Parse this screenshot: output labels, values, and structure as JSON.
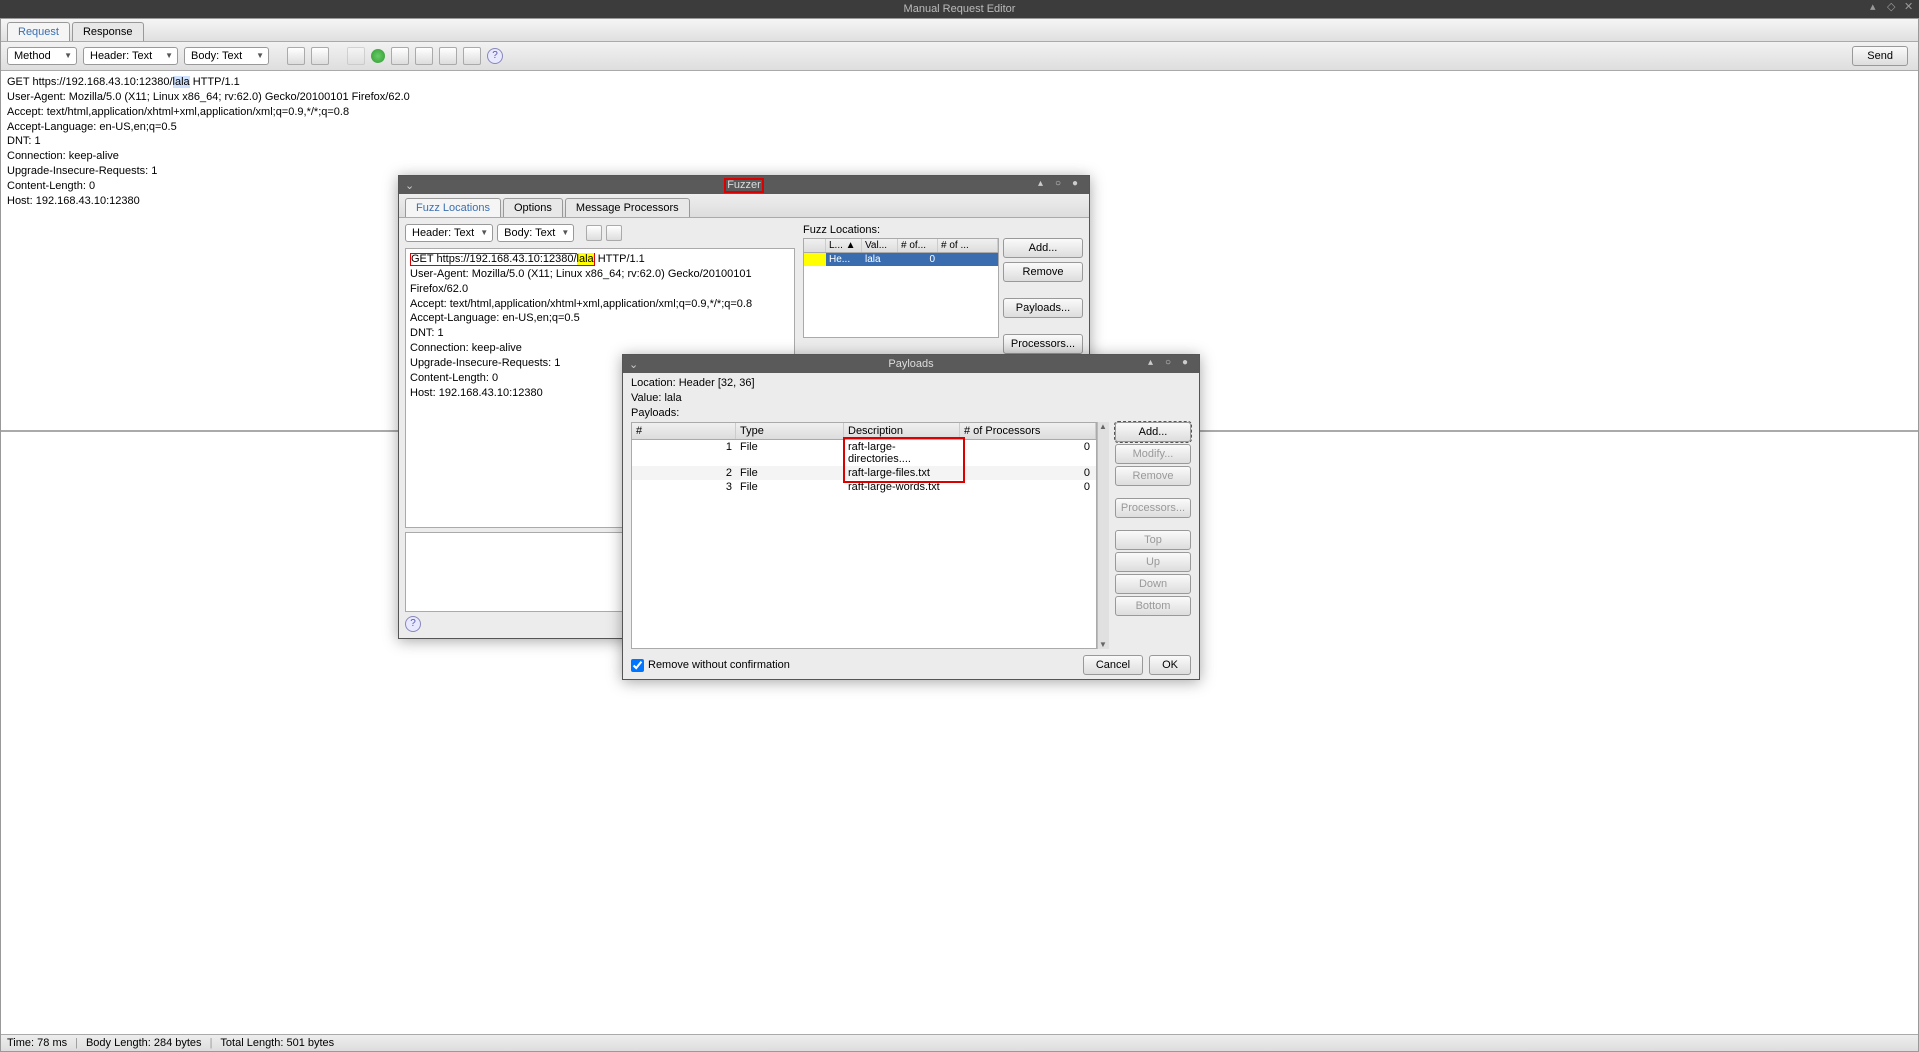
{
  "window": {
    "title": "Manual Request Editor"
  },
  "tabs": {
    "request": "Request",
    "response": "Response"
  },
  "toolbar": {
    "method": "Method",
    "header_text": "Header: Text",
    "body_text": "Body: Text",
    "send": "Send"
  },
  "request_pre": "GET https://192.168.43.10:12380/",
  "request_highlight": "lala",
  "request_post": " HTTP/1.1\nUser-Agent: Mozilla/5.0 (X11; Linux x86_64; rv:62.0) Gecko/20100101 Firefox/62.0\nAccept: text/html,application/xhtml+xml,application/xml;q=0.9,*/*;q=0.8\nAccept-Language: en-US,en;q=0.5\nDNT: 1\nConnection: keep-alive\nUpgrade-Insecure-Requests: 1\nContent-Length: 0\nHost: 192.168.43.10:12380",
  "status": {
    "time": "Time: 78 ms",
    "body_len": "Body Length: 284 bytes",
    "total_len": "Total Length: 501 bytes"
  },
  "fuzzer": {
    "title": "Fuzzer",
    "tabs": {
      "fl": "Fuzz Locations",
      "opt": "Options",
      "mp": "Message Processors"
    },
    "mini": {
      "header_text": "Header: Text",
      "body_text": "Body: Text"
    },
    "req_line1_pre": "GET https://192.168.43.10:12380/",
    "req_line1_hl": "lala",
    "req_line1_post": " HTTP/1.1",
    "req_body_rest": "User-Agent: Mozilla/5.0 (X11; Linux x86_64; rv:62.0) Gecko/20100101 Firefox/62.0\nAccept: text/html,application/xhtml+xml,application/xml;q=0.9,*/*;q=0.8\nAccept-Language: en-US,en;q=0.5\nDNT: 1\nConnection: keep-alive\nUpgrade-Insecure-Requests: 1\nContent-Length: 0\nHost: 192.168.43.10:12380",
    "fl_label": "Fuzz Locations:",
    "fl_headers": {
      "c1": "L... ▲",
      "c2": "Val...",
      "c3": "# of...",
      "c4": "# of ..."
    },
    "fl_row": {
      "c1": "He...",
      "c2": "lala",
      "c3": "0",
      "c4": ""
    },
    "btns": {
      "add": "Add...",
      "remove": "Remove",
      "payloads": "Payloads...",
      "processors": "Processors..."
    }
  },
  "payloads": {
    "title": "Payloads",
    "location_label": "Location:",
    "location_value": "Header [32, 36]",
    "value_label": "Value:",
    "value_value": "lala",
    "payloads_label": "Payloads:",
    "headers": {
      "num": "#",
      "type": "Type",
      "desc": "Description",
      "proc": "# of Processors"
    },
    "rows": [
      {
        "num": "1",
        "type": "File",
        "desc": "raft-large-directories....",
        "proc": "0"
      },
      {
        "num": "2",
        "type": "File",
        "desc": "raft-large-files.txt",
        "proc": "0"
      },
      {
        "num": "3",
        "type": "File",
        "desc": "raft-large-words.txt",
        "proc": "0"
      }
    ],
    "btns": {
      "add": "Add...",
      "modify": "Modify...",
      "remove": "Remove",
      "processors": "Processors...",
      "top": "Top",
      "up": "Up",
      "down": "Down",
      "bottom": "Bottom"
    },
    "remove_cb": "Remove without confirmation",
    "cancel": "Cancel",
    "ok": "OK"
  }
}
